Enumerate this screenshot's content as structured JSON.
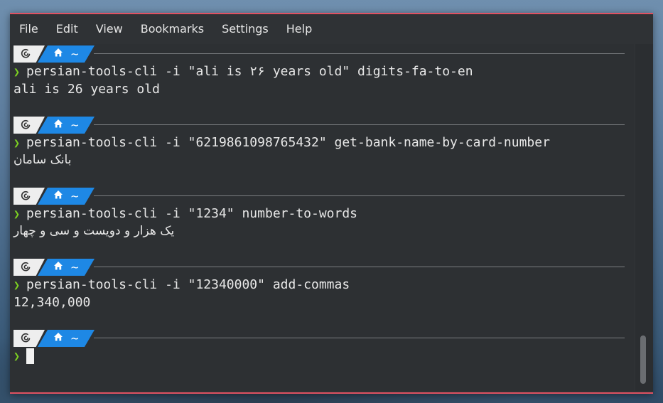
{
  "menu": {
    "items": [
      "File",
      "Edit",
      "View",
      "Bookmarks",
      "Settings",
      "Help"
    ]
  },
  "prompt": {
    "dir_symbol": "~",
    "caret": "❯",
    "os_icon": "debian-swirl-icon",
    "dir_icon": "home-icon"
  },
  "entries": [
    {
      "command": "persian-tools-cli -i \"ali is ۲۶ years old\" digits-fa-to-en",
      "output": "ali is 26 years old"
    },
    {
      "command": "persian-tools-cli -i \"6219861098765432\" get-bank-name-by-card-number",
      "output": "بانک سامان"
    },
    {
      "command": "persian-tools-cli -i \"1234\" number-to-words",
      "output": "یک هزار و دویست و سی و چهار"
    },
    {
      "command": "persian-tools-cli -i \"12340000\" add-commas",
      "output": "12,340,000"
    }
  ],
  "colors": {
    "accent_border": "#e05262",
    "dir_segment": "#1e88e5",
    "prompt_caret": "#7ed321",
    "terminal_bg": "#2d3033"
  }
}
